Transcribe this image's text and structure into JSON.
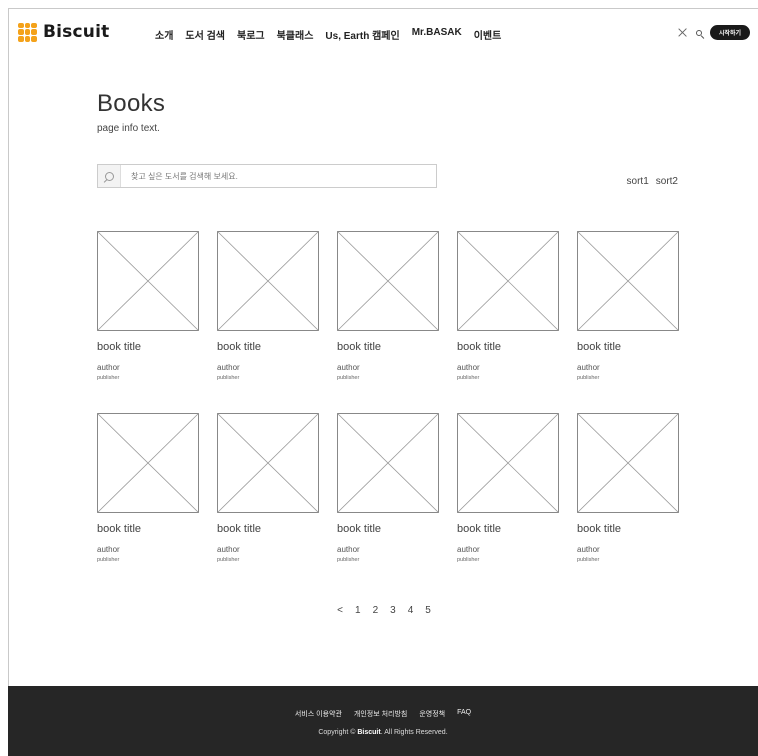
{
  "header": {
    "logo_text": "Biscuit",
    "nav": [
      {
        "label": "소개"
      },
      {
        "label": "도서 검색"
      },
      {
        "label": "북로그"
      },
      {
        "label": "북클래스"
      },
      {
        "label": "Us, Earth 캠페인"
      },
      {
        "label": "Mr.BASAK"
      },
      {
        "label": "이벤트"
      }
    ],
    "start_button": "시작하기"
  },
  "page": {
    "title": "Books",
    "info": "page info text."
  },
  "search": {
    "placeholder": "찾고 싶은 도서를 검색해 보세요."
  },
  "sort": [
    "sort1",
    "sort2"
  ],
  "books": [
    {
      "title": "book title",
      "author": "author",
      "publisher": "publisher"
    },
    {
      "title": "book title",
      "author": "author",
      "publisher": "publisher"
    },
    {
      "title": "book title",
      "author": "author",
      "publisher": "publisher"
    },
    {
      "title": "book title",
      "author": "author",
      "publisher": "publisher"
    },
    {
      "title": "book title",
      "author": "author",
      "publisher": "publisher"
    },
    {
      "title": "book title",
      "author": "author",
      "publisher": "publisher"
    },
    {
      "title": "book title",
      "author": "author",
      "publisher": "publisher"
    },
    {
      "title": "book title",
      "author": "author",
      "publisher": "publisher"
    },
    {
      "title": "book title",
      "author": "author",
      "publisher": "publisher"
    },
    {
      "title": "book title",
      "author": "author",
      "publisher": "publisher"
    }
  ],
  "pagination": {
    "prev": "<",
    "pages": [
      "1",
      "2",
      "3",
      "4",
      "5"
    ]
  },
  "footer": {
    "links": [
      "서비스 이용약관",
      "개인정보 처리방침",
      "운영정책",
      "FAQ"
    ],
    "copyright_prefix": "Copyright © ",
    "copyright_brand": "Biscuit",
    "copyright_suffix": ". All Rights Reserved."
  },
  "colors": {
    "brand": "#f4a21a",
    "footer_bg": "#262626"
  }
}
